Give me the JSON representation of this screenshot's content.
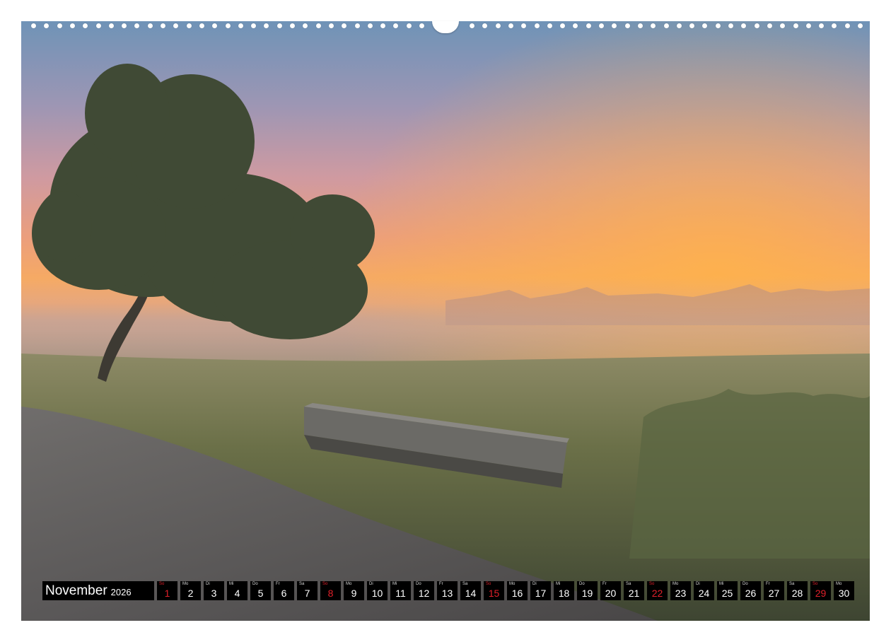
{
  "calendar": {
    "month": "November",
    "year": "2026",
    "days": [
      {
        "weekday": "So",
        "day": "1",
        "sunday": true
      },
      {
        "weekday": "Mo",
        "day": "2",
        "sunday": false
      },
      {
        "weekday": "Di",
        "day": "3",
        "sunday": false
      },
      {
        "weekday": "Mi",
        "day": "4",
        "sunday": false
      },
      {
        "weekday": "Do",
        "day": "5",
        "sunday": false
      },
      {
        "weekday": "Fr",
        "day": "6",
        "sunday": false
      },
      {
        "weekday": "Sa",
        "day": "7",
        "sunday": false
      },
      {
        "weekday": "So",
        "day": "8",
        "sunday": true
      },
      {
        "weekday": "Mo",
        "day": "9",
        "sunday": false
      },
      {
        "weekday": "Di",
        "day": "10",
        "sunday": false
      },
      {
        "weekday": "Mi",
        "day": "11",
        "sunday": false
      },
      {
        "weekday": "Do",
        "day": "12",
        "sunday": false
      },
      {
        "weekday": "Fr",
        "day": "13",
        "sunday": false
      },
      {
        "weekday": "Sa",
        "day": "14",
        "sunday": false
      },
      {
        "weekday": "So",
        "day": "15",
        "sunday": true
      },
      {
        "weekday": "Mo",
        "day": "16",
        "sunday": false
      },
      {
        "weekday": "Di",
        "day": "17",
        "sunday": false
      },
      {
        "weekday": "Mi",
        "day": "18",
        "sunday": false
      },
      {
        "weekday": "Do",
        "day": "19",
        "sunday": false
      },
      {
        "weekday": "Fr",
        "day": "20",
        "sunday": false
      },
      {
        "weekday": "Sa",
        "day": "21",
        "sunday": false
      },
      {
        "weekday": "So",
        "day": "22",
        "sunday": true
      },
      {
        "weekday": "Mo",
        "day": "23",
        "sunday": false
      },
      {
        "weekday": "Di",
        "day": "24",
        "sunday": false
      },
      {
        "weekday": "Mi",
        "day": "25",
        "sunday": false
      },
      {
        "weekday": "Do",
        "day": "26",
        "sunday": false
      },
      {
        "weekday": "Fr",
        "day": "27",
        "sunday": false
      },
      {
        "weekday": "Sa",
        "day": "28",
        "sunday": false
      },
      {
        "weekday": "So",
        "day": "29",
        "sunday": true
      },
      {
        "weekday": "Mo",
        "day": "30",
        "sunday": false
      }
    ]
  },
  "colors": {
    "strip_background": "#000000",
    "sunday_red": "#e0202a",
    "text_white": "#ffffff"
  }
}
